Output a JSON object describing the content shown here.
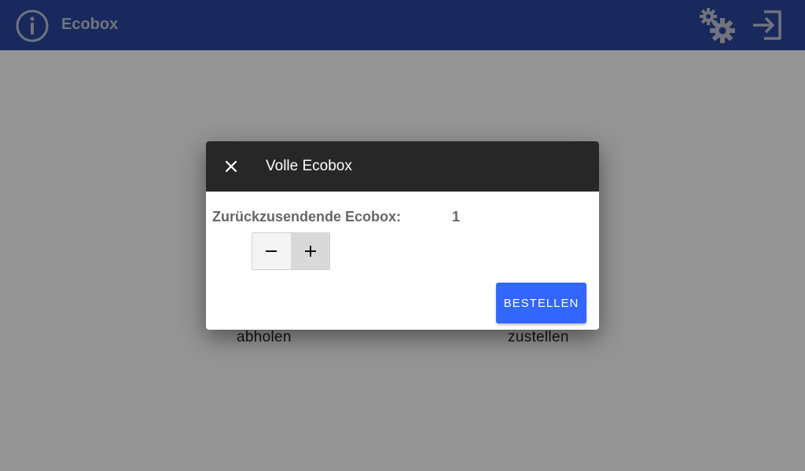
{
  "app": {
    "title": "Ecobox",
    "icons": {
      "info": "info-circle-icon",
      "settings": "gears-icon",
      "logout": "sign-in-icon"
    }
  },
  "page": {
    "left_option_label": "abholen",
    "right_option_label": "zustellen"
  },
  "dialog": {
    "title": "Volle Ecobox",
    "close_icon": "close-icon",
    "field_label": "Zurückzusendende Ecobox:",
    "field_value": "1",
    "stepper": {
      "minus_icon": "minus-icon",
      "plus_icon": "plus-icon"
    },
    "order_button_label": "BESTELLEN"
  },
  "colors": {
    "appbar": "#2b47a0",
    "dialog_header": "#272727",
    "primary_button": "#3366ff"
  }
}
